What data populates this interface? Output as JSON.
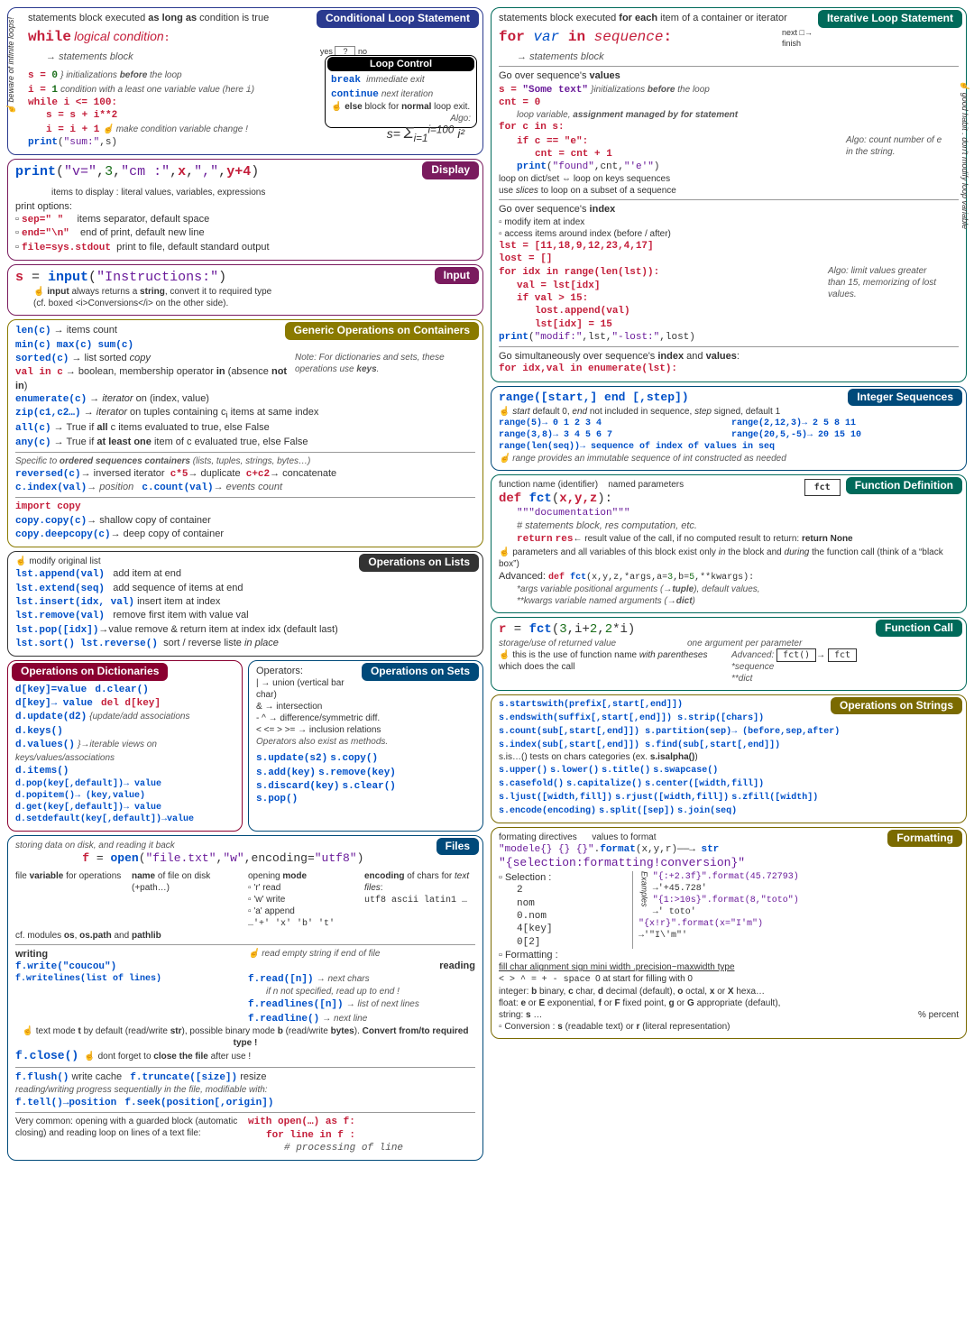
{
  "cond": {
    "title": "Conditional Loop Statement",
    "desc": "statements block executed <b>as long as</b> condition is true",
    "syntax_kw": "while",
    "syntax_rest": "logical condition",
    "stmt": "statements block",
    "yes": "yes",
    "no": "no",
    "side": "☝ beware of infinite loops!",
    "init_code": "s = 0\ni = 1",
    "init_note": "initializations <b>before</b> the loop",
    "cond_note": "condition with a least one variable value (here <span class='mono'>i</span>)",
    "loop_head": "while i <= 100:",
    "loop_body1": "s = s + i**2",
    "loop_body2": "i = i + 1",
    "loop_note": "☝ make condition variable change !",
    "print": "print(\"sum:\",s)",
    "algo": "Algo:",
    "sum_formula": "s = Σ i² (i=1 to i=100)"
  },
  "loopctrl": {
    "title": "Loop Control",
    "break": "break",
    "break_desc": "immediate exit",
    "continue": "continue",
    "continue_desc": "next iteration",
    "else_desc": "☝ <b>else</b> block for <b>normal</b> loop exit."
  },
  "iter": {
    "title": "Iterative Loop Statement",
    "desc": "statements block executed <b>for each</b> item of a container or iterator",
    "syntax": "for var in sequence:",
    "stmt": "statements block",
    "next": "next",
    "finish": "finish",
    "side": "☝ good habit : don't modify loop variable",
    "values_title": "Go over sequence's <b>values</b>",
    "init1": "s = \"Some text\"",
    "init1_note": "initializations <b>before</b> the loop",
    "init2": "cnt = 0",
    "loop_var_note": "loop variable, <b>assignment managed by for statement</b>",
    "for_head": "for c in s:",
    "if_line": "if c == \"e\":",
    "cnt_line": "cnt = cnt + 1",
    "algo_note": "Algo: count number of e in the string.",
    "print_line": "print(\"found\",cnt,\"'e'\")",
    "dict_note": "loop on dict/set ⇔ loop on keys sequences",
    "slice_note": "use <i>slices</i> to loop on a subset of a sequence",
    "index_title": "Go over sequence's <b>index</b>",
    "index_b1": "▫ modify item at index",
    "index_b2": "▫ access items around index (before / after)",
    "lst_init": "lst = [11,18,9,12,23,4,17]",
    "lost_init": "lost = []",
    "for_idx": "for idx in range(len(lst)):",
    "val_line": "val = lst[idx]",
    "if_val": "if val > 15:",
    "lost_append": "lost.append(val)",
    "lst_assign": "lst[idx] = 15",
    "idx_algo": "Algo: limit values greater than 15, memorizing of lost values.",
    "print_modif": "print(\"modif:\",lst,\"-lost:\",lost)",
    "enum_title": "Go simultaneously over sequence's <b>index</b> and <b>values</b>:",
    "enum_code": "for idx,val in enumerate(lst):"
  },
  "display": {
    "title": "Display",
    "code": "print(\"v=\",3,\"cm :\",x,\",\",y+4)",
    "desc": "items to display : literal values, variables, expressions",
    "options": "print options:",
    "sep": "sep=\" \"",
    "sep_desc": "items separator, default space",
    "end": "end=\"\\n\"",
    "end_desc": "end of print, default new line",
    "file": "file=sys.stdout",
    "file_desc": "print to file, default standard output"
  },
  "input": {
    "title": "Input",
    "code": "s = input(\"Instructions:\")",
    "note1": "☝ <b>input</b> always returns a <b>string</b>, convert it to required type",
    "note2": "(cf. boxed <i>Conversions</i> on the other side)."
  },
  "generic": {
    "title": "Generic Operations on Containers",
    "len": "len(c)",
    "len_desc": "→ items count",
    "min": "min(c)",
    "max": "max(c)",
    "sum": "sum(c)",
    "dict_note": "Note: For dictionaries and sets, these operations use <b>keys</b>.",
    "sorted": "sorted(c)",
    "sorted_desc": "→ list sorted <i>copy</i>",
    "in": "val in c",
    "in_desc": "→ boolean, membership operator <b>in</b> (absence <b>not in</b>)",
    "enum": "enumerate(c)",
    "enum_desc": "→ <i>iterator</i> on (index, value)",
    "zip": "zip(c1,c2…)",
    "zip_desc": "→ <i>iterator</i> on tuples containing c<sub>i</sub> items at same index",
    "all": "all(c)",
    "all_desc": "→ True if <b>all</b> c items evaluated to true, else False",
    "any": "any(c)",
    "any_desc": "→ True if <b>at least one</b> item of c evaluated true, else False",
    "ordered_note": "Specific to <b>ordered sequences containers</b> (lists, tuples, strings, bytes…)",
    "reversed": "reversed(c)",
    "reversed_desc": "→ inversed iterator",
    "dup": "c*5",
    "dup_desc": "→ duplicate",
    "concat": "c+c2",
    "concat_desc": "→ concatenate",
    "index": "c.index(val)",
    "index_desc": "→ position",
    "count": "c.count(val)",
    "count_desc": "→ events count",
    "import_copy": "import copy",
    "shallow": "copy.copy(c)",
    "shallow_desc": "→ shallow copy of container",
    "deep": "copy.deepcopy(c)",
    "deep_desc": "→ deep copy of container"
  },
  "lists": {
    "title": "Operations on Lists",
    "modify": "☝ modify original list",
    "append": "lst.append(val)",
    "append_desc": "add item at end",
    "extend": "lst.extend(seq)",
    "extend_desc": "add sequence of items at end",
    "insert": "lst.insert(idx, val)",
    "insert_desc": "insert item at index",
    "remove": "lst.remove(val)",
    "remove_desc": "remove first item with value val",
    "pop": "lst.pop([idx])",
    "pop_desc": "→value   remove & return item at index idx (default last)",
    "sort": "lst.sort()",
    "reverse": "lst.reverse()",
    "sort_desc": "sort / reverse liste <i>in place</i>"
  },
  "dicts": {
    "title": "Operations on Dictionaries",
    "set": "d[key]=value",
    "get": "d[key]→ value",
    "clear": "d.clear()",
    "del": "del d[key]",
    "update": "d.update(d2)",
    "update_desc": "update/add associations",
    "keys": "d.keys()",
    "values": "d.values()",
    "items": "d.items()",
    "views_desc": "→<i>iterable views on keys/values/associations</i>",
    "pop": "d.pop(key[,default])→ value",
    "popitem": "d.popitem()→ (key,value)",
    "dget": "d.get(key[,default])→ value",
    "setdefault": "d.setdefault(key[,default])→value"
  },
  "sets": {
    "title": "Operations on Sets",
    "ops": "Operators:",
    "union": "| → union (vertical bar char)",
    "inter": "& → intersection",
    "diff": "- ^ → difference/symmetric diff.",
    "rel": "< <= > >= → inclusion relations",
    "methods": "Operators also exist as methods.",
    "update": "s.update(s2)",
    "copy": "s.copy()",
    "add": "s.add(key)",
    "remove": "s.remove(key)",
    "discard": "s.discard(key)",
    "clear": "s.clear()",
    "pop": "s.pop()"
  },
  "files": {
    "title": "Files",
    "desc": "storing data on disk, and reading it back",
    "open": "f = open(\"file.txt\",\"w\",encoding=\"utf8\")",
    "var_label": "file <b>variable</b> for operations",
    "name_label": "<b>name</b> of file on disk (+path…)",
    "mode_label": "opening <b>mode</b>",
    "mode_r": "▫ 'r' read",
    "mode_w": "▫ 'w' write",
    "mode_a": "▫ 'a' append",
    "mode_more": "…'+' 'x' 'b' 't'",
    "enc_label": "<b>encoding</b> of chars for <i>text files</i>:",
    "enc_vals": "utf8  ascii  latin1  …",
    "modules": "cf. modules <b>os</b>, <b>os.path</b> and <b>pathlib</b>",
    "writing": "writing",
    "reading": "reading",
    "read_empty": "☝ read empty string if end of file",
    "write": "f.write(\"coucou\")",
    "writelines": "f.writelines(list of lines)",
    "read": "f.read([n])",
    "read_desc": "→ next chars",
    "read_n": "if n not specified, read up to end !",
    "readlines": "f.readlines([n])",
    "readlines_desc": "→ list of next lines",
    "readline": "f.readline()",
    "readline_desc": "→ next line",
    "text_mode": "☝ text mode <b>t</b> by default (read/write <b>str</b>), possible binary mode <b>b</b> (read/write <b>bytes</b>). <b>Convert from/to required type !</b>",
    "close": "f.close()",
    "close_desc": "☝ dont forget to <b>close the file</b> after use !",
    "flush": "f.flush()",
    "flush_desc": "write cache",
    "truncate": "f.truncate([size])",
    "truncate_desc": "resize",
    "seek_desc": "reading/writing progress sequentially in the file, modifiable with:",
    "tell": "f.tell()→position",
    "seek": "f.seek(position[,origin])",
    "common": "Very common: opening with a guarded block (automatic closing) and reading loop on lines of a text file:",
    "with": "with open(…) as f:",
    "forline": "for line in f :",
    "proc": "# processing of line"
  },
  "intseq": {
    "title": "Integer Sequences",
    "syntax": "range([start,] end [,step])",
    "note": "☝ <i>start</i> default 0, <i>end</i> not included in sequence, <i>step</i> signed, default 1",
    "ex1": "range(5)→ 0 1 2 3 4",
    "ex2": "range(2,12,3)→ 2 5 8 11",
    "ex3": "range(3,8)→ 3 4 5 6 7",
    "ex4": "range(20,5,-5)→ 20 15 10",
    "ex5": "range(len(seq))→ sequence of index of values in seq",
    "immutable": "☝ range provides an immutable sequence of int constructed as needed"
  },
  "funcdef": {
    "title": "Function Definition",
    "fname": "function name (identifier)",
    "params": "named parameters",
    "def": "def fct(x,y,z):",
    "doc": "\"\"\"documentation\"\"\"",
    "stmt": "# statements block, res computation, etc.",
    "return": "return res",
    "return_desc": "← result value of the call, if no computed result to return: <b>return None</b>",
    "params_note": "☝ parameters and all variables of this block exist only <i>in</i> the block and <i>during</i> the function call (think of a “black box”)",
    "advanced": "Advanced:",
    "adv_code": "def fct(x,y,z,*args,a=3,b=5,**kwargs):",
    "args_desc": "*args variable positional arguments (→<b>tuple</b>), default values,",
    "kwargs_desc": "**kwargs variable named arguments (→<b>dict</b>)",
    "fct_box": "fct"
  },
  "funccall": {
    "title": "Function Call",
    "code": "r = fct(3,i+2,2*i)",
    "storage": "storage/use of returned value",
    "arg": "one argument per parameter",
    "use": "☝ this is the use of function name <i>with parentheses</i> which does the call",
    "adv": "Advanced:",
    "adv_seq": "*sequence",
    "adv_dict": "**dict",
    "fct_call": "fct()",
    "fct_box": "fct"
  },
  "strings": {
    "title": "Operations on Strings",
    "startswith": "s.startswith(prefix[,start[,end]])",
    "endswith": "s.endswith(suffix[,start[,end]])",
    "strip": "s.strip([chars])",
    "count": "s.count(sub[,start[,end]])",
    "partition": "s.partition(sep)→ (before,sep,after)",
    "index": "s.index(sub[,start[,end]])",
    "find": "s.find(sub[,start[,end]])",
    "is": "s.is…()  tests on chars categories (ex. <b>s.isalpha()</b>)",
    "upper": "s.upper()",
    "lower": "s.lower()",
    "titlec": "s.title()",
    "swap": "s.swapcase()",
    "casefold": "s.casefold()",
    "cap": "s.capitalize()",
    "center": "s.center([width,fill])",
    "ljust": "s.ljust([width,fill])",
    "rjust": "s.rjust([width,fill])",
    "zfill": "s.zfill([width])",
    "encode": "s.encode(encoding)",
    "split": "s.split([sep])",
    "join": "s.join(seq)"
  },
  "fmt": {
    "title": "Formatting",
    "directives": "formating directives",
    "values": "values to format",
    "model": "\"modele{} {} {}\".format(x,y,r)",
    "result": "str",
    "syntax": "\"{selection:formatting!conversion}\"",
    "sel": "▫ Selection :",
    "sel_2": "2",
    "sel_nom": "nom",
    "sel_0nom": "0.nom",
    "sel_4key": "4[key]",
    "sel_02": "0[2]",
    "ex_label": "Examples",
    "ex1": "\"{:+2.3f}\".format(45.72793)",
    "ex1r": "→'+45.728'",
    "ex2": "\"{1:>10s}\".format(8,\"toto\")",
    "ex2r": "→'      toto'",
    "ex3": "\"{x!r}\".format(x=\"I'm\")",
    "ex3r": "→'\"I\\'m\"'",
    "fmt_label": "▫ Formatting :",
    "parts": "fill char  alignment  sign  mini width .precision~maxwidth  type",
    "align": "< > ^ =",
    "sign": "+ - space",
    "zero": "0 at start for filling with 0",
    "types": "integer: <b>b</b> binary, <b>c</b> char, <b>d</b> decimal (default), <b>o</b> octal, <b>x</b> or <b>X</b> hexa…",
    "float": "float: <b>e</b> or <b>E</b> exponential, <b>f</b> or <b>F</b> fixed point, <b>g</b> or <b>G</b> appropriate (default),",
    "string": "string: <b>s</b> …",
    "percent": "% percent",
    "conv": "▫ Conversion : <b>s</b> (readable text) or <b>r</b> (literal representation)"
  }
}
